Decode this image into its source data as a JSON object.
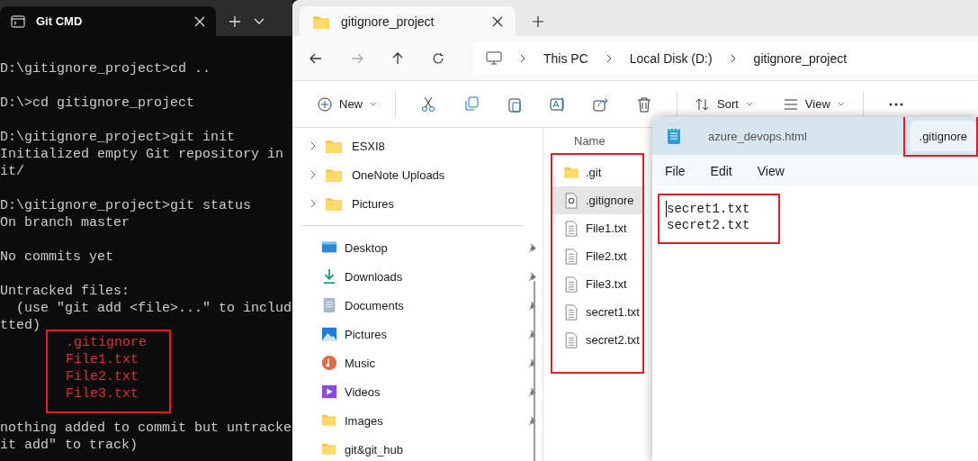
{
  "terminal": {
    "title": "Git CMD",
    "blocks": [
      {
        "lines": [
          {
            "text": "D:\\gitignore_project>cd ..",
            "kind": "plain"
          }
        ]
      },
      {
        "lines": [
          {
            "text": "D:\\>cd gitignore_project",
            "kind": "plain"
          }
        ]
      },
      {
        "lines": [
          {
            "text": "D:\\gitignore_project>git init",
            "kind": "plain"
          },
          {
            "text": "Initialized empty Git repository in",
            "kind": "plain"
          },
          {
            "text": "it/",
            "kind": "plain"
          }
        ]
      },
      {
        "lines": [
          {
            "text": "D:\\gitignore_project>git status",
            "kind": "plain"
          },
          {
            "text": "On branch master",
            "kind": "plain"
          }
        ]
      },
      {
        "lines": [
          {
            "text": "No commits yet",
            "kind": "plain"
          }
        ]
      },
      {
        "lines": [
          {
            "text": "Untracked files:",
            "kind": "plain"
          },
          {
            "text": "  (use \"git add <file>...\" to includ",
            "kind": "plain"
          },
          {
            "text": "tted)",
            "kind": "plain"
          },
          {
            "text": ".gitignore",
            "kind": "untracked"
          },
          {
            "text": "File1.txt",
            "kind": "untracked"
          },
          {
            "text": "File2.txt",
            "kind": "untracked"
          },
          {
            "text": "File3.txt",
            "kind": "untracked"
          }
        ]
      },
      {
        "lines": [
          {
            "text": "nothing added to commit but untracke",
            "kind": "plain"
          },
          {
            "text": "it add\" to track)",
            "kind": "plain"
          }
        ]
      }
    ]
  },
  "explorer": {
    "tab_title": "gitignore_project",
    "breadcrumb": [
      "This PC",
      "Local Disk (D:)",
      "gitignore_project"
    ],
    "toolbar": [
      {
        "label": "New",
        "kind": "new"
      },
      {
        "label": "Sort",
        "kind": "sort"
      },
      {
        "label": "View",
        "kind": "view"
      }
    ],
    "tree": [
      {
        "label": "ESXI8",
        "expandable": true
      },
      {
        "label": "OneNote Uploads",
        "expandable": true
      },
      {
        "label": "Pictures",
        "expandable": true
      }
    ],
    "quick_access": [
      {
        "label": "Desktop",
        "kind": "desktop",
        "pinned": true
      },
      {
        "label": "Downloads",
        "kind": "downloads",
        "pinned": true
      },
      {
        "label": "Documents",
        "kind": "documents",
        "pinned": true
      },
      {
        "label": "Pictures",
        "kind": "pictures",
        "pinned": true
      },
      {
        "label": "Music",
        "kind": "music",
        "pinned": true
      },
      {
        "label": "Videos",
        "kind": "videos",
        "pinned": true
      },
      {
        "label": "Images",
        "kind": "folder",
        "pinned": true
      },
      {
        "label": "git&git_hub",
        "kind": "folder",
        "pinned": false
      }
    ],
    "column_header": "Name",
    "files_highlighted": true,
    "files": [
      {
        "name": ".git",
        "kind": "folder",
        "selected": false
      },
      {
        "name": ".gitignore",
        "kind": "config",
        "selected": true
      },
      {
        "name": "File1.txt",
        "kind": "text",
        "selected": false
      },
      {
        "name": "File2.txt",
        "kind": "text",
        "selected": false
      },
      {
        "name": "File3.txt",
        "kind": "text",
        "selected": false
      },
      {
        "name": "secret1.txt",
        "kind": "text",
        "selected": false
      },
      {
        "name": "secret2.txt",
        "kind": "text",
        "selected": false
      }
    ]
  },
  "notepad": {
    "tabs": [
      {
        "label": "azure_devops.html",
        "selected": false,
        "highlighted": false
      },
      {
        "label": ".gitignore",
        "selected": true,
        "highlighted": true
      }
    ],
    "menu": [
      "File",
      "Edit",
      "View"
    ],
    "content_highlighted": true,
    "content": [
      "secret1.txt",
      "secret2.txt"
    ]
  }
}
